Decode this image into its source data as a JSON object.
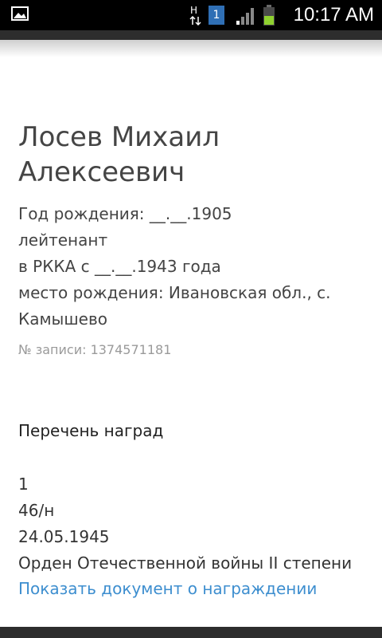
{
  "status_bar": {
    "time": "10:17 AM",
    "notification_count": "1",
    "network_indicator": "H",
    "icons": [
      "image-icon",
      "network-h-icon",
      "notification-icon",
      "signal-icon",
      "battery-icon"
    ]
  },
  "person": {
    "name_line1": "Лосев Михаил",
    "name_line2": "Алексеевич",
    "birth_year": "Год рождения: __.__.1905",
    "rank": "лейтенант",
    "service": "в РККА с __.__.1943 года",
    "birthplace_line1": "место рождения: Ивановская обл., с.",
    "birthplace_line2": "Камышево",
    "record_number": "№ записи: 1374571181"
  },
  "awards": {
    "title": "Перечень наград",
    "items": [
      {
        "index": "1",
        "number": "46/н",
        "date": "24.05.1945",
        "name": "Орден Отечественной войны II степени",
        "link_text": "Показать документ о награждении"
      }
    ]
  },
  "colors": {
    "link": "#3d8ecf",
    "text": "#444444",
    "muted": "#9a9a9a",
    "status_bar": "#000000"
  }
}
